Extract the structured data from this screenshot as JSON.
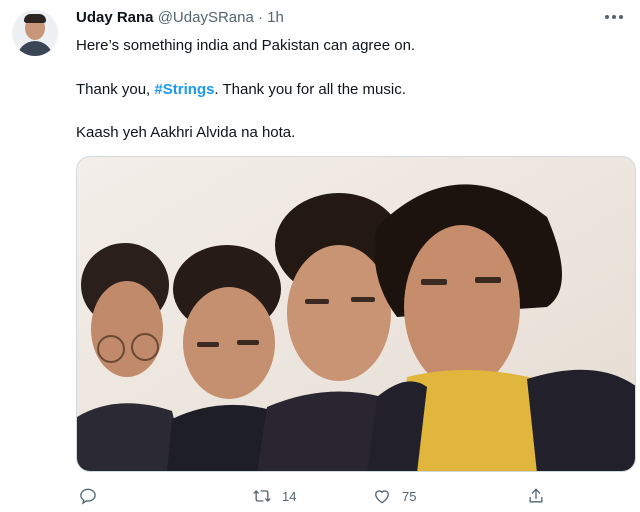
{
  "tweet": {
    "user": {
      "name": "Uday Rana",
      "handle": "@UdaySRana",
      "time": "1h"
    },
    "text": {
      "line1": "Here’s something india and Pakistan can agree on.",
      "line2_before": "Thank you, ",
      "hashtag": "#Strings",
      "line2_after": ". Thank you for all the music.",
      "line3": "Kaash yeh Aakhri Alvida na hota."
    },
    "actions": {
      "reply": {
        "icon": "reply-icon"
      },
      "retweet": {
        "icon": "retweet-icon",
        "count": "14"
      },
      "like": {
        "icon": "heart-icon",
        "count": "75"
      },
      "share": {
        "icon": "share-icon"
      }
    },
    "colors": {
      "accent": "#1d9bf0",
      "secondary_text": "#536471",
      "border": "#cfd9de"
    }
  }
}
